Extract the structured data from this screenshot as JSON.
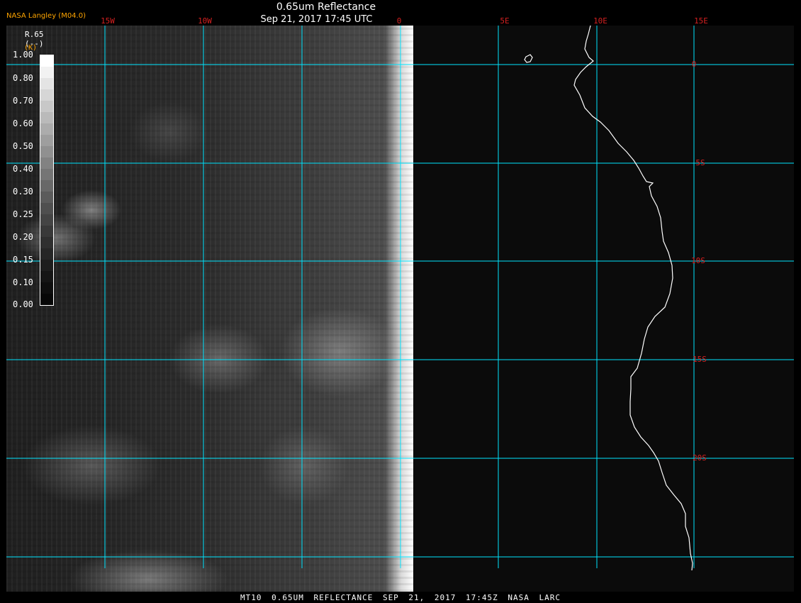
{
  "header": {
    "credit": "NASA Langley (M04.0)",
    "title": "0.65um Reflectance",
    "datetime": "Sep 21, 2017 17:45 UTC"
  },
  "colorbar": {
    "unit_name": "R.65",
    "unit_sub": "(--)",
    "unit_k": "(K)",
    "ticks": [
      "1.00",
      "0.80",
      "0.70",
      "0.60",
      "0.50",
      "0.40",
      "0.30",
      "0.25",
      "0.20",
      "0.15",
      "0.10",
      "0.00"
    ]
  },
  "map": {
    "lon_labels": [
      "15W",
      "10W",
      "0",
      "5E",
      "10E",
      "15E"
    ],
    "lat_labels": [
      "0",
      "5S",
      "10S",
      "15S",
      "20S"
    ],
    "colors": {
      "grid": "#00e5ff",
      "labels": "#d42020",
      "coast": "#ffffff"
    }
  },
  "footer": {
    "text": "MT10 0.65UM REFLECTANCE SEP 21, 2017 17:45Z NASA LARC"
  }
}
